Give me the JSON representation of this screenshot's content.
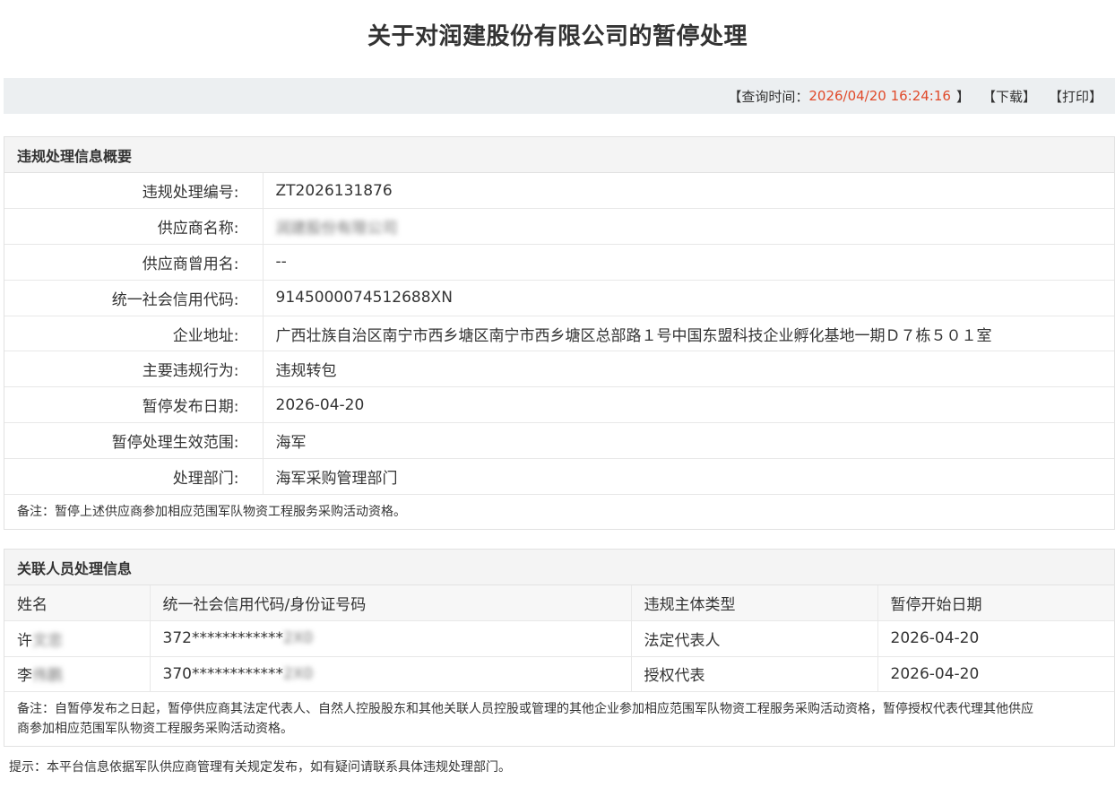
{
  "title": "关于对润建股份有限公司的暂停处理",
  "query": {
    "label_prefix": "【查询时间：",
    "time": "2026/04/20 16:24:16",
    "label_suffix": "】",
    "download": "【下载】",
    "print": "【打印】"
  },
  "summary": {
    "header": "违规处理信息概要",
    "rows": [
      {
        "label": "违规处理编号:",
        "value": "ZT2026131876"
      },
      {
        "label": "供应商名称:",
        "value": "润建股份有限公司"
      },
      {
        "label": "供应商曾用名:",
        "value": "--"
      },
      {
        "label": "统一社会信用代码:",
        "value": "9145000074512688XN"
      },
      {
        "label": "企业地址:",
        "value": "广西壮族自治区南宁市西乡塘区南宁市西乡塘区总部路１号中国东盟科技企业孵化基地一期Ｄ７栋５０１室"
      },
      {
        "label": "主要违规行为:",
        "value": "违规转包"
      },
      {
        "label": "暂停发布日期:",
        "value": "2026-04-20"
      },
      {
        "label": "暂停处理生效范围:",
        "value": "海军"
      },
      {
        "label": "处理部门:",
        "value": "海军采购管理部门"
      }
    ],
    "note": "备注：暂停上述供应商参加相应范围军队物资工程服务采购活动资格。"
  },
  "persons": {
    "header": "关联人员处理信息",
    "columns": [
      "姓名",
      "统一社会信用代码/身份证号码",
      "违规主体类型",
      "暂停开始日期"
    ],
    "rows": [
      {
        "name_visible": "许",
        "name_hidden": "文忠",
        "id_visible": "372************",
        "id_hidden": "2X0",
        "type": "法定代表人",
        "date": "2026-04-20"
      },
      {
        "name_visible": "李",
        "name_hidden": "伟鹏",
        "id_visible": "370************",
        "id_hidden": "2X0",
        "type": "授权代表",
        "date": "2026-04-20"
      }
    ],
    "note_line1": "备注：自暂停发布之日起，暂停供应商其法定代表人、自然人控股股东和其他关联人员控股或管理的其他企业参加相应范围军队物资工程服务采购活动资格，暂停授权代表代理其他供应",
    "note_line2": "商参加相应范围军队物资工程服务采购活动资格。"
  },
  "tip": "提示：本平台信息依据军队供应商管理有关规定发布，如有疑问请联系具体违规处理部门。"
}
